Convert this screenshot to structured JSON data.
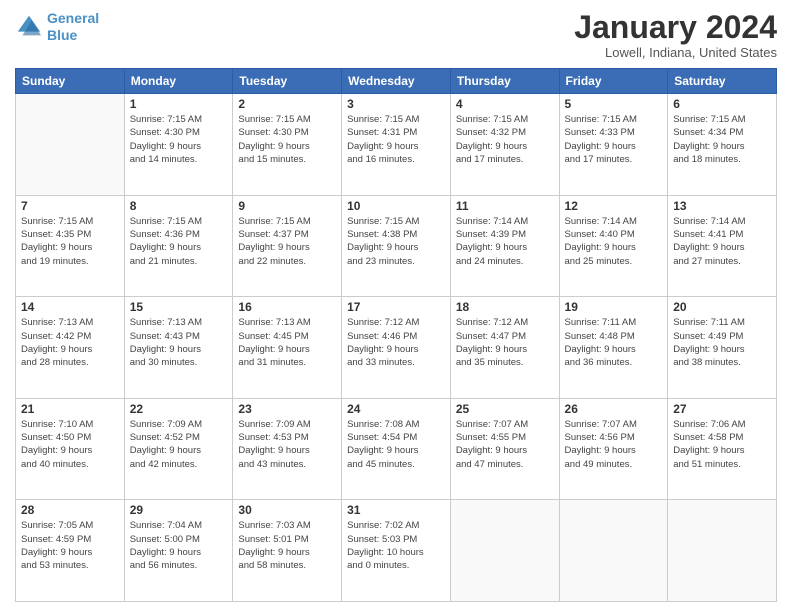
{
  "header": {
    "logo_line1": "General",
    "logo_line2": "Blue",
    "month_title": "January 2024",
    "location": "Lowell, Indiana, United States"
  },
  "days_of_week": [
    "Sunday",
    "Monday",
    "Tuesday",
    "Wednesday",
    "Thursday",
    "Friday",
    "Saturday"
  ],
  "weeks": [
    [
      {
        "day": "",
        "info": ""
      },
      {
        "day": "1",
        "info": "Sunrise: 7:15 AM\nSunset: 4:30 PM\nDaylight: 9 hours\nand 14 minutes."
      },
      {
        "day": "2",
        "info": "Sunrise: 7:15 AM\nSunset: 4:30 PM\nDaylight: 9 hours\nand 15 minutes."
      },
      {
        "day": "3",
        "info": "Sunrise: 7:15 AM\nSunset: 4:31 PM\nDaylight: 9 hours\nand 16 minutes."
      },
      {
        "day": "4",
        "info": "Sunrise: 7:15 AM\nSunset: 4:32 PM\nDaylight: 9 hours\nand 17 minutes."
      },
      {
        "day": "5",
        "info": "Sunrise: 7:15 AM\nSunset: 4:33 PM\nDaylight: 9 hours\nand 17 minutes."
      },
      {
        "day": "6",
        "info": "Sunrise: 7:15 AM\nSunset: 4:34 PM\nDaylight: 9 hours\nand 18 minutes."
      }
    ],
    [
      {
        "day": "7",
        "info": "Sunrise: 7:15 AM\nSunset: 4:35 PM\nDaylight: 9 hours\nand 19 minutes."
      },
      {
        "day": "8",
        "info": "Sunrise: 7:15 AM\nSunset: 4:36 PM\nDaylight: 9 hours\nand 21 minutes."
      },
      {
        "day": "9",
        "info": "Sunrise: 7:15 AM\nSunset: 4:37 PM\nDaylight: 9 hours\nand 22 minutes."
      },
      {
        "day": "10",
        "info": "Sunrise: 7:15 AM\nSunset: 4:38 PM\nDaylight: 9 hours\nand 23 minutes."
      },
      {
        "day": "11",
        "info": "Sunrise: 7:14 AM\nSunset: 4:39 PM\nDaylight: 9 hours\nand 24 minutes."
      },
      {
        "day": "12",
        "info": "Sunrise: 7:14 AM\nSunset: 4:40 PM\nDaylight: 9 hours\nand 25 minutes."
      },
      {
        "day": "13",
        "info": "Sunrise: 7:14 AM\nSunset: 4:41 PM\nDaylight: 9 hours\nand 27 minutes."
      }
    ],
    [
      {
        "day": "14",
        "info": "Sunrise: 7:13 AM\nSunset: 4:42 PM\nDaylight: 9 hours\nand 28 minutes."
      },
      {
        "day": "15",
        "info": "Sunrise: 7:13 AM\nSunset: 4:43 PM\nDaylight: 9 hours\nand 30 minutes."
      },
      {
        "day": "16",
        "info": "Sunrise: 7:13 AM\nSunset: 4:45 PM\nDaylight: 9 hours\nand 31 minutes."
      },
      {
        "day": "17",
        "info": "Sunrise: 7:12 AM\nSunset: 4:46 PM\nDaylight: 9 hours\nand 33 minutes."
      },
      {
        "day": "18",
        "info": "Sunrise: 7:12 AM\nSunset: 4:47 PM\nDaylight: 9 hours\nand 35 minutes."
      },
      {
        "day": "19",
        "info": "Sunrise: 7:11 AM\nSunset: 4:48 PM\nDaylight: 9 hours\nand 36 minutes."
      },
      {
        "day": "20",
        "info": "Sunrise: 7:11 AM\nSunset: 4:49 PM\nDaylight: 9 hours\nand 38 minutes."
      }
    ],
    [
      {
        "day": "21",
        "info": "Sunrise: 7:10 AM\nSunset: 4:50 PM\nDaylight: 9 hours\nand 40 minutes."
      },
      {
        "day": "22",
        "info": "Sunrise: 7:09 AM\nSunset: 4:52 PM\nDaylight: 9 hours\nand 42 minutes."
      },
      {
        "day": "23",
        "info": "Sunrise: 7:09 AM\nSunset: 4:53 PM\nDaylight: 9 hours\nand 43 minutes."
      },
      {
        "day": "24",
        "info": "Sunrise: 7:08 AM\nSunset: 4:54 PM\nDaylight: 9 hours\nand 45 minutes."
      },
      {
        "day": "25",
        "info": "Sunrise: 7:07 AM\nSunset: 4:55 PM\nDaylight: 9 hours\nand 47 minutes."
      },
      {
        "day": "26",
        "info": "Sunrise: 7:07 AM\nSunset: 4:56 PM\nDaylight: 9 hours\nand 49 minutes."
      },
      {
        "day": "27",
        "info": "Sunrise: 7:06 AM\nSunset: 4:58 PM\nDaylight: 9 hours\nand 51 minutes."
      }
    ],
    [
      {
        "day": "28",
        "info": "Sunrise: 7:05 AM\nSunset: 4:59 PM\nDaylight: 9 hours\nand 53 minutes."
      },
      {
        "day": "29",
        "info": "Sunrise: 7:04 AM\nSunset: 5:00 PM\nDaylight: 9 hours\nand 56 minutes."
      },
      {
        "day": "30",
        "info": "Sunrise: 7:03 AM\nSunset: 5:01 PM\nDaylight: 9 hours\nand 58 minutes."
      },
      {
        "day": "31",
        "info": "Sunrise: 7:02 AM\nSunset: 5:03 PM\nDaylight: 10 hours\nand 0 minutes."
      },
      {
        "day": "",
        "info": ""
      },
      {
        "day": "",
        "info": ""
      },
      {
        "day": "",
        "info": ""
      }
    ]
  ]
}
